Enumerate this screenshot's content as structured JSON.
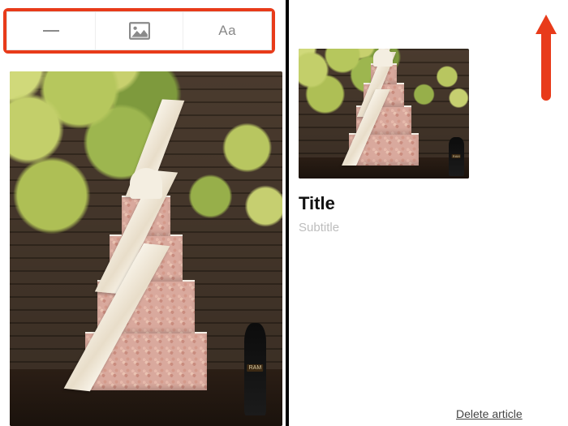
{
  "annotations": {
    "left_highlight_color": "#e83b1a",
    "arrow_color": "#e83b1a"
  },
  "left": {
    "toolbar": {
      "divider_icon": "horizontal-rule-icon",
      "image_icon": "image-icon",
      "text_label": "Aa"
    }
  },
  "right": {
    "title_placeholder": "Title",
    "subtitle_placeholder": "Subtitle",
    "delete_label": "Delete article",
    "thumb_bottle_label": "RAM"
  }
}
